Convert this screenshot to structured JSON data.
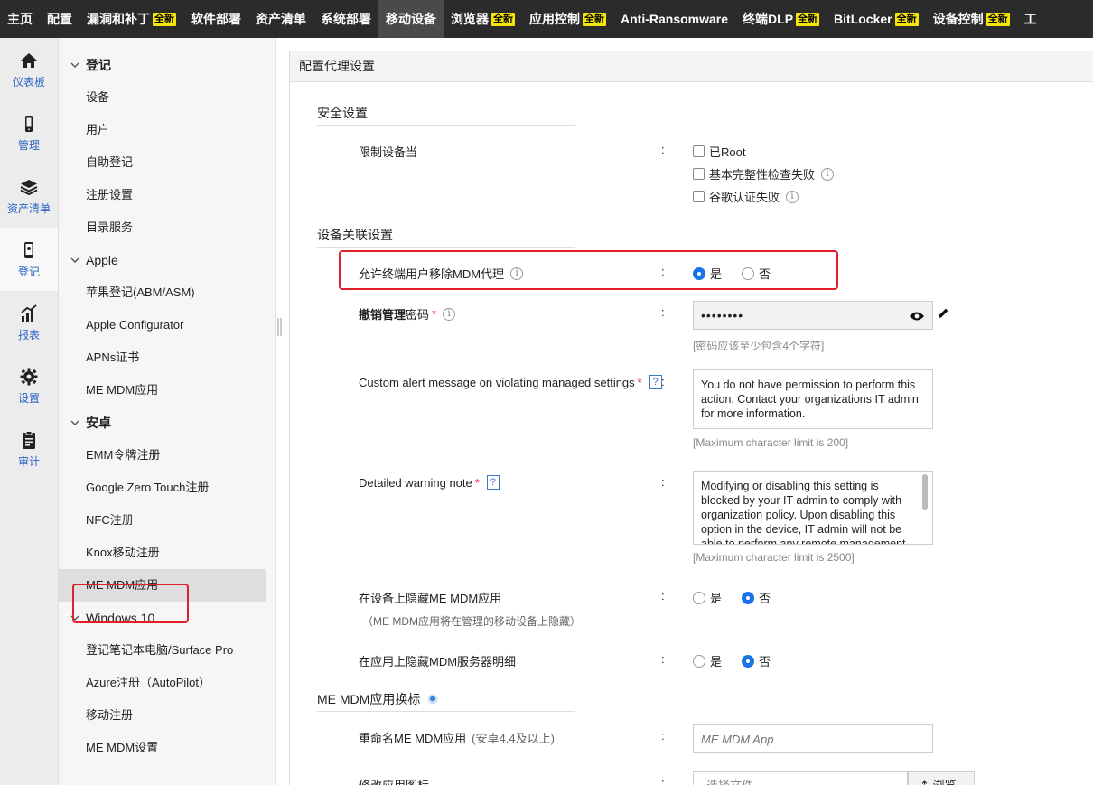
{
  "topnav": {
    "tabs": [
      {
        "label": "主页",
        "badge": ""
      },
      {
        "label": "配置",
        "badge": ""
      },
      {
        "label": "漏洞和补丁",
        "badge": "全新"
      },
      {
        "label": "软件部署",
        "badge": ""
      },
      {
        "label": "资产清单",
        "badge": ""
      },
      {
        "label": "系统部署",
        "badge": ""
      },
      {
        "label": "移动设备",
        "badge": "",
        "active": true
      },
      {
        "label": "浏览器",
        "badge": "全新"
      },
      {
        "label": "应用控制",
        "badge": "全新"
      },
      {
        "label": "Anti-Ransomware",
        "badge": ""
      },
      {
        "label": "终端DLP",
        "badge": "全新"
      },
      {
        "label": "BitLocker",
        "badge": "全新"
      },
      {
        "label": "设备控制",
        "badge": "全新"
      },
      {
        "label": "工",
        "badge": ""
      }
    ]
  },
  "rail": {
    "items": [
      {
        "label": "仪表板",
        "icon": "home-icon"
      },
      {
        "label": "管理",
        "icon": "phone-icon"
      },
      {
        "label": "资产清单",
        "icon": "layers-icon"
      },
      {
        "label": "登记",
        "icon": "device-enroll-icon",
        "active": true
      },
      {
        "label": "报表",
        "icon": "report-icon"
      },
      {
        "label": "设置",
        "icon": "gear-icon"
      },
      {
        "label": "审计",
        "icon": "clipboard-icon"
      }
    ]
  },
  "sidebar": {
    "groups": [
      {
        "title": "登记",
        "bold": true,
        "items": [
          "设备",
          "用户",
          "自助登记",
          "注册设置",
          "目录服务"
        ]
      },
      {
        "title": "Apple",
        "bold": false,
        "items": [
          "苹果登记(ABM/ASM)",
          "Apple Configurator",
          "APNs证书",
          "ME MDM应用"
        ]
      },
      {
        "title": "安卓",
        "bold": true,
        "items": [
          "EMM令牌注册",
          "Google Zero Touch注册",
          "NFC注册",
          "Knox移动注册",
          "ME MDM应用"
        ]
      },
      {
        "title": "Windows 10",
        "bold": false,
        "items": [
          "登记笔记本电脑/Surface Pro",
          "Azure注册（AutoPilot）",
          "移动注册",
          "ME MDM设置"
        ]
      }
    ]
  },
  "panel": {
    "title": "配置代理设置",
    "security": {
      "section": "安全设置",
      "restrict_label": "限制设备当",
      "options": [
        "已Root",
        "基本完整性检查失败",
        "谷歌认证失败"
      ]
    },
    "association": {
      "section": "设备关联设置",
      "allow_remove_label": "允许终端用户移除MDM代理",
      "yes": "是",
      "no": "否",
      "revoke_label_bold": "撤销管理",
      "revoke_label_rest": "密码",
      "password_value": "••••••••",
      "password_hint": "[密码应该至少包含4个字符]",
      "alert_label": "Custom alert message on violating managed settings",
      "alert_value": "You do not have permission to perform this action. Contact your organizations IT admin for more information.",
      "alert_hint": "[Maximum character limit is 200]",
      "warning_label": "Detailed warning note",
      "warning_value": "Modifying or disabling this setting is blocked by your IT admin to comply with organization policy. Upon disabling this option in the device, IT admin will not be able to perform any remote management",
      "warning_hint": "[Maximum character limit is 2500]",
      "hide_app_label": "在设备上隐藏ME MDM应用",
      "hide_app_note": "（ME MDM应用将在管理的移动设备上隐藏）",
      "hide_server_label": "在应用上隐藏MDM服务器明细"
    },
    "rebrand": {
      "section": "ME MDM应用换标",
      "rename_label": "重命名ME MDM应用",
      "rename_note": "(安卓4.4及以上)",
      "rename_placeholder": "ME MDM App",
      "icon_label": "修改应用图标",
      "file_placeholder": "选择文件",
      "browse": "浏览"
    },
    "colon": ":",
    "qmark": "?"
  }
}
